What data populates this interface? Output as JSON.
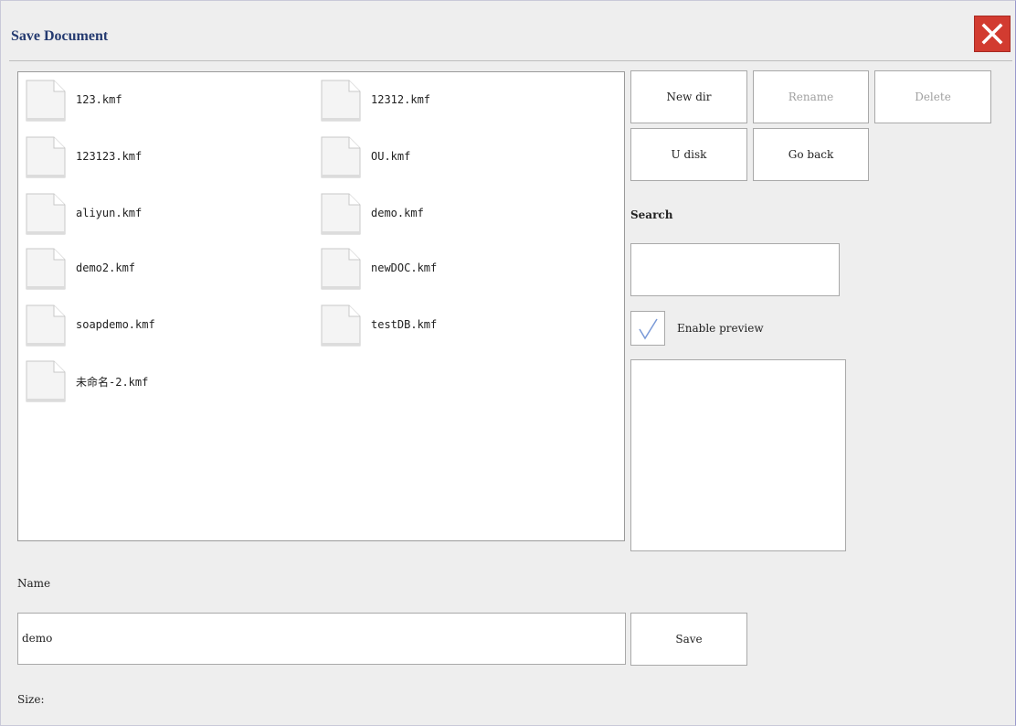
{
  "dialog": {
    "title": "Save Document"
  },
  "files": [
    {
      "name": "123.kmf"
    },
    {
      "name": "12312.kmf"
    },
    {
      "name": "123123.kmf"
    },
    {
      "name": "OU.kmf"
    },
    {
      "name": "aliyun.kmf"
    },
    {
      "name": "demo.kmf"
    },
    {
      "name": "demo2.kmf"
    },
    {
      "name": "newDOC.kmf"
    },
    {
      "name": "soapdemo.kmf"
    },
    {
      "name": "testDB.kmf"
    },
    {
      "name": "未命名-2.kmf"
    }
  ],
  "toolbar": {
    "new_dir": "New dir",
    "rename": "Rename",
    "delete": "Delete",
    "u_disk": "U disk",
    "go_back": "Go back"
  },
  "search": {
    "label": "Search",
    "value": ""
  },
  "preview": {
    "label": "Enable preview",
    "checked": true
  },
  "name_field": {
    "label": "Name",
    "value": "demo"
  },
  "save_label": "Save",
  "size_label": "Size:",
  "colors": {
    "close_bg": "#d23b30",
    "title_text": "#243a70",
    "check_mark": "#7a9ad8"
  },
  "icons": {
    "close": "close-icon",
    "file": "document-icon",
    "check": "checkmark-icon"
  }
}
